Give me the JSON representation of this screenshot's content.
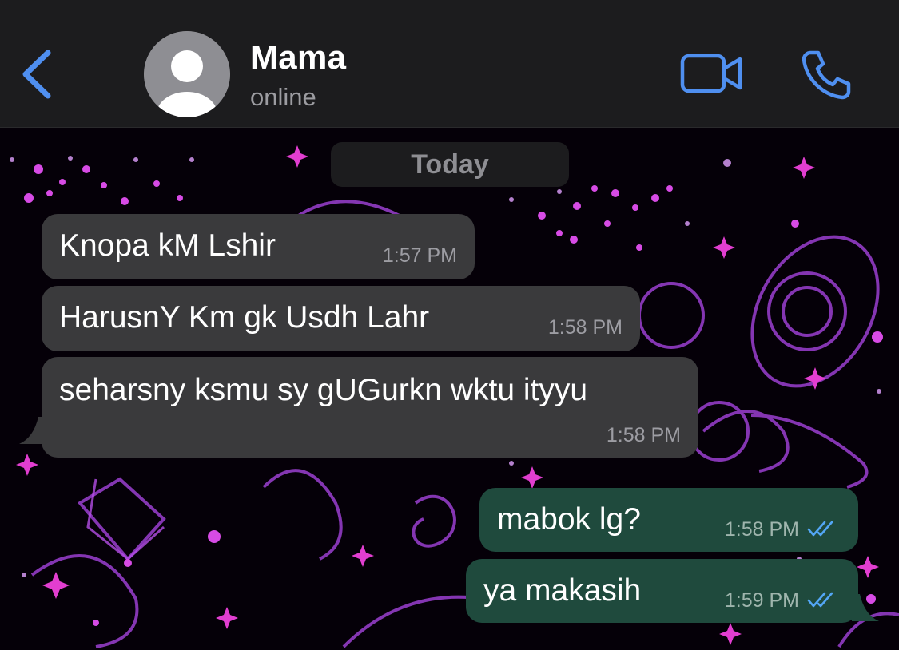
{
  "header": {
    "contact_name": "Mama",
    "status": "online"
  },
  "chat": {
    "date_label": "Today",
    "messages": [
      {
        "direction": "incoming",
        "text": "Knopa kM Lshir",
        "time": "1:57 PM"
      },
      {
        "direction": "incoming",
        "text": "HarusnY Km gk Usdh Lahr",
        "time": "1:58 PM"
      },
      {
        "direction": "incoming",
        "text": "seharsny ksmu sy gUGurkn wktu ityyu",
        "time": "1:58 PM"
      },
      {
        "direction": "outgoing",
        "text": "mabok lg?",
        "time": "1:58 PM",
        "status": "read"
      },
      {
        "direction": "outgoing",
        "text": "ya makasih",
        "time": "1:59 PM",
        "status": "read"
      }
    ]
  },
  "colors": {
    "accent": "#4f8ff0",
    "header_bg": "#1c1c1e",
    "incoming_bubble": "#3a3a3c",
    "outgoing_bubble": "#1f4a3d",
    "read_ticks": "#53a6f5"
  },
  "icons": {
    "back": "chevron-left-icon",
    "video": "video-camera-icon",
    "call": "phone-icon",
    "read": "double-check-icon"
  }
}
